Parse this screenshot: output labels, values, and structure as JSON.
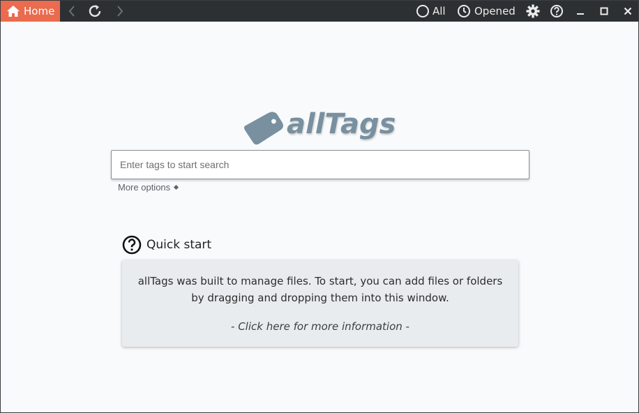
{
  "titlebar": {
    "home_label": "Home",
    "all_label": "All",
    "opened_label": "Opened",
    "icons": [
      "home-icon",
      "back-icon",
      "refresh-icon",
      "forward-icon",
      "circle-icon",
      "clock-icon",
      "gear-icon",
      "help-icon",
      "minimize-icon",
      "maximize-icon",
      "close-icon"
    ]
  },
  "logo": {
    "text": "allTags"
  },
  "search": {
    "placeholder": "Enter tags to start search",
    "value": ""
  },
  "more_options": {
    "label": "More options"
  },
  "quick_start": {
    "title": "Quick start",
    "body": "allTags was built to manage files. To start, you can add files or folders by dragging and dropping them into this window.",
    "link": "- Click here for more information -"
  },
  "colors": {
    "titlebar_bg": "#2d3033",
    "home_accent": "#ea6b4e",
    "logo_color": "#7890a0",
    "card_bg": "#e9ecee"
  }
}
